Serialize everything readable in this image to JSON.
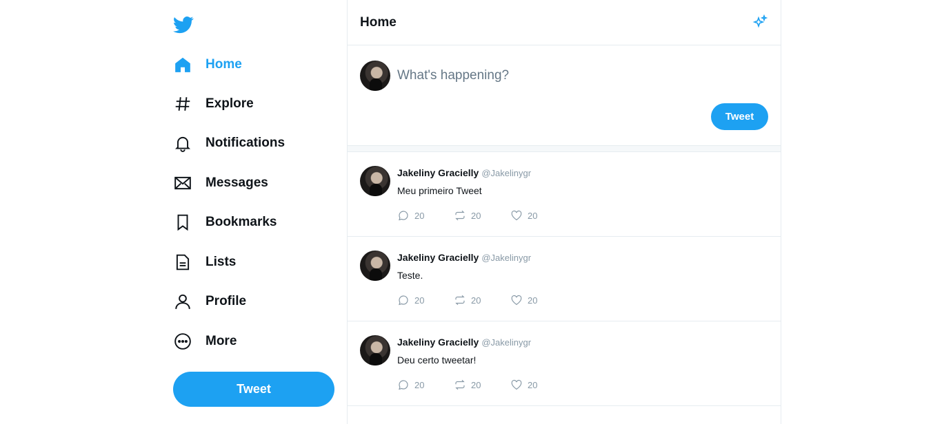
{
  "sidebar": {
    "items": [
      {
        "label": "Home",
        "icon": "home-icon",
        "active": true
      },
      {
        "label": "Explore",
        "icon": "hashtag-icon"
      },
      {
        "label": "Notifications",
        "icon": "bell-icon"
      },
      {
        "label": "Messages",
        "icon": "envelope-icon"
      },
      {
        "label": "Bookmarks",
        "icon": "bookmark-icon"
      },
      {
        "label": "Lists",
        "icon": "list-document-icon"
      },
      {
        "label": "Profile",
        "icon": "user-icon"
      },
      {
        "label": "More",
        "icon": "more-circle-icon"
      }
    ],
    "tweet_button": "Tweet"
  },
  "header": {
    "title": "Home"
  },
  "composer": {
    "placeholder": "What's happening?",
    "tweet_button": "Tweet"
  },
  "tweets": [
    {
      "name": "Jakeliny Gracielly",
      "handle": "@Jakelinygr",
      "text": "Meu primeiro Tweet",
      "replies": "20",
      "retweets": "20",
      "likes": "20"
    },
    {
      "name": "Jakeliny Gracielly",
      "handle": "@Jakelinygr",
      "text": "Teste.",
      "replies": "20",
      "retweets": "20",
      "likes": "20"
    },
    {
      "name": "Jakeliny Gracielly",
      "handle": "@Jakelinygr",
      "text": "Deu certo tweetar!",
      "replies": "20",
      "retweets": "20",
      "likes": "20"
    }
  ],
  "colors": {
    "accent": "#1da1f2",
    "text": "#0f1419",
    "muted": "#8899a6",
    "border": "#e6ecf0"
  }
}
